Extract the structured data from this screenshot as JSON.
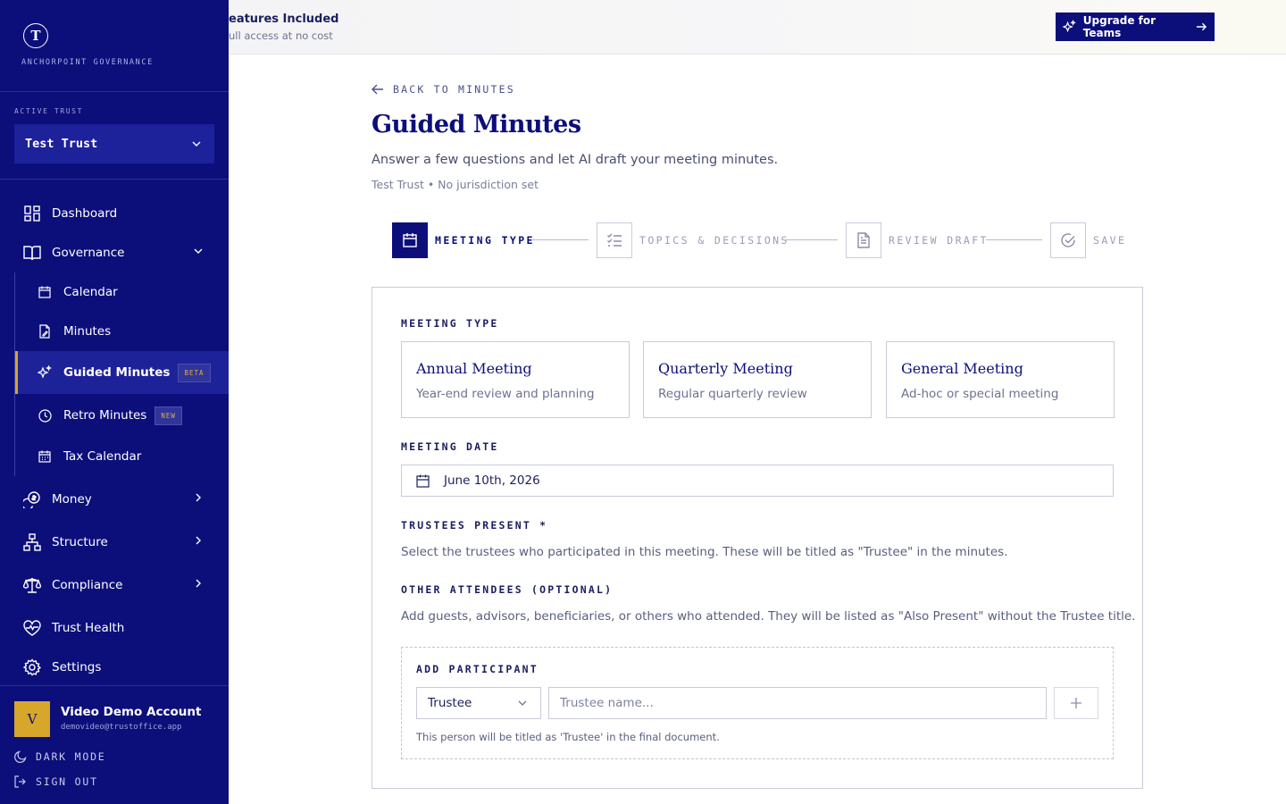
{
  "brand": {
    "logo_letter": "T",
    "name": "ANCHORPOINT GOVERNANCE"
  },
  "trust": {
    "label": "ACTIVE TRUST",
    "selected": "Test Trust"
  },
  "nav": {
    "dashboard": "Dashboard",
    "governance": "Governance",
    "governance_children": {
      "calendar": "Calendar",
      "minutes": "Minutes",
      "guided_minutes": "Guided Minutes",
      "guided_minutes_badge": "BETA",
      "retro_minutes": "Retro Minutes",
      "retro_minutes_badge": "NEW",
      "tax_calendar": "Tax Calendar"
    },
    "money": "Money",
    "structure": "Structure",
    "compliance": "Compliance",
    "trust_health": "Trust Health",
    "settings": "Settings"
  },
  "user": {
    "avatar_initial": "V",
    "name": "Video Demo Account",
    "email": "demovideo@trustoffice.app",
    "dark_mode": "DARK MODE",
    "sign_out": "SIGN OUT"
  },
  "banner": {
    "title": "eatures Included",
    "subtitle": "ull access at no cost",
    "upgrade_label": "Upgrade for Teams"
  },
  "page": {
    "back_link": "BACK TO MINUTES",
    "title": "Guided Minutes",
    "subtitle": "Answer a few questions and let AI draft your meeting minutes.",
    "meta": "Test Trust • No jurisdiction set"
  },
  "steps": [
    {
      "label": "MEETING TYPE",
      "active": true
    },
    {
      "label": "TOPICS & DECISIONS",
      "active": false
    },
    {
      "label": "REVIEW DRAFT",
      "active": false
    },
    {
      "label": "SAVE",
      "active": false
    }
  ],
  "form": {
    "meeting_type_label": "MEETING TYPE",
    "meeting_types": [
      {
        "title": "Annual Meeting",
        "desc": "Year-end review and planning"
      },
      {
        "title": "Quarterly Meeting",
        "desc": "Regular quarterly review"
      },
      {
        "title": "General Meeting",
        "desc": "Ad-hoc or special meeting"
      }
    ],
    "meeting_date_label": "MEETING DATE",
    "meeting_date_value": "June 10th, 2026",
    "trustees_label": "TRUSTEES PRESENT *",
    "trustees_help": "Select the trustees who participated in this meeting. These will be titled as \"Trustee\" in the minutes.",
    "others_label": "OTHER ATTENDEES (OPTIONAL)",
    "others_help": "Add guests, advisors, beneficiaries, or others who attended. They will be listed as \"Also Present\" without the Trustee title.",
    "add_participant_label": "ADD PARTICIPANT",
    "role_selected": "Trustee",
    "name_placeholder": "Trustee name...",
    "add_button": "+",
    "role_note": "This person will be titled as 'Trustee' in the final document."
  },
  "colors": {
    "primary": "#0c0f7a",
    "accent": "#d6a72a",
    "sidebar_bg": "#0c0f7a"
  }
}
